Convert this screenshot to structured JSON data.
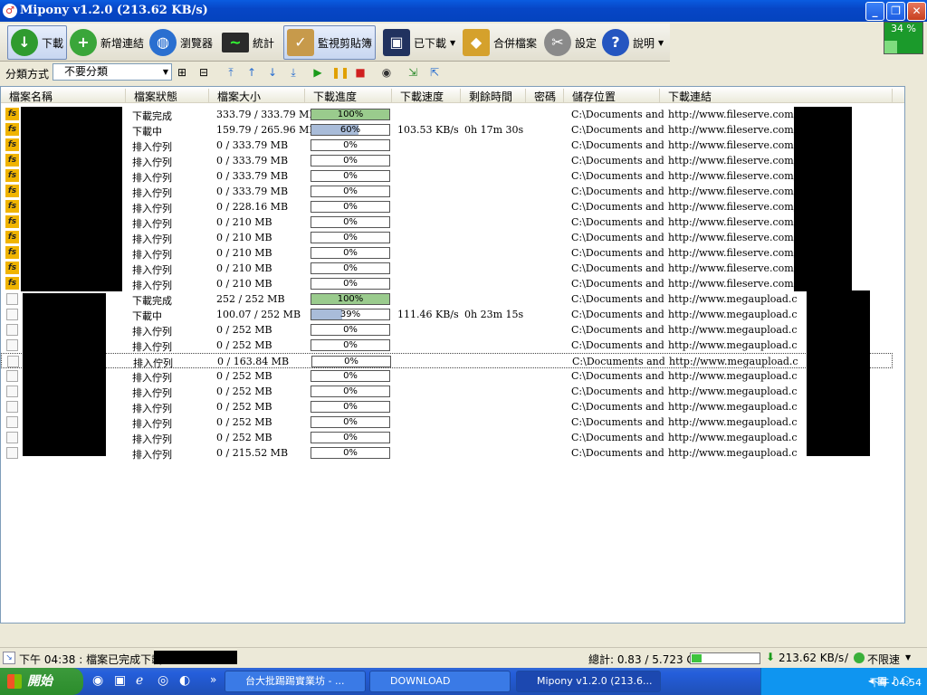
{
  "window": {
    "title": "Mipony v1.2.0 (213.62 KB/s)",
    "speed_meter": {
      "percent_label": "34 %",
      "fraction": 0.34
    }
  },
  "toolbar": {
    "download": "下載",
    "add_link": "新增連結",
    "browser": "瀏覽器",
    "stats": "統計",
    "monitor_clipboard": "監視剪貼簿",
    "downloaded": "已下載",
    "merge_files": "合併檔案",
    "settings": "設定",
    "help": "說明"
  },
  "subbar": {
    "sort_label": "分類方式",
    "sort_value": "不要分類"
  },
  "columns": [
    "檔案名稱",
    "檔案狀態",
    "檔案大小",
    "下載進度",
    "下載速度",
    "剩餘時間",
    "密碼",
    "儲存位置",
    "下載連結"
  ],
  "rows": [
    {
      "host": "fs",
      "status": "下載完成",
      "size": "333.79 / 333.79 MB",
      "progress": 100,
      "progress_label": "100%",
      "speed": "",
      "remaining": "",
      "location": "C:\\Documents and...",
      "link": "http://www.fileserve.com/file/j"
    },
    {
      "host": "fs",
      "status": "下載中",
      "size": "159.79 / 265.96 MB",
      "progress": 60,
      "progress_label": "60%",
      "speed": "103.53 KB/s",
      "remaining": "0h 17m 30s",
      "location": "C:\\Documents and...",
      "link": "http://www.fileserve.com/file/r"
    },
    {
      "host": "fs",
      "status": "排入佇列",
      "size": "0 / 333.79 MB",
      "progress": 0,
      "progress_label": "0%",
      "speed": "",
      "remaining": "",
      "location": "C:\\Documents and...",
      "link": "http://www.fileserve.com/file/8"
    },
    {
      "host": "fs",
      "status": "排入佇列",
      "size": "0 / 333.79 MB",
      "progress": 0,
      "progress_label": "0%",
      "speed": "",
      "remaining": "",
      "location": "C:\\Documents and...",
      "link": "http://www.fileserve.com/file/c"
    },
    {
      "host": "fs",
      "status": "排入佇列",
      "size": "0 / 333.79 MB",
      "progress": 0,
      "progress_label": "0%",
      "speed": "",
      "remaining": "",
      "location": "C:\\Documents and...",
      "link": "http://www.fileserve.com/file/2"
    },
    {
      "host": "fs",
      "status": "排入佇列",
      "size": "0 / 333.79 MB",
      "progress": 0,
      "progress_label": "0%",
      "speed": "",
      "remaining": "",
      "location": "C:\\Documents and...",
      "link": "http://www.fileserve.com/file/h"
    },
    {
      "host": "fs",
      "status": "排入佇列",
      "size": "0 / 228.16 MB",
      "progress": 0,
      "progress_label": "0%",
      "speed": "",
      "remaining": "",
      "location": "C:\\Documents and...",
      "link": "http://www.fileserve.com/file/a"
    },
    {
      "host": "fs",
      "status": "排入佇列",
      "size": "0 / 210 MB",
      "progress": 0,
      "progress_label": "0%",
      "speed": "",
      "remaining": "",
      "location": "C:\\Documents and...",
      "link": "http://www.fileserve.com/file/q"
    },
    {
      "host": "fs",
      "status": "排入佇列",
      "size": "0 / 210 MB",
      "progress": 0,
      "progress_label": "0%",
      "speed": "",
      "remaining": "",
      "location": "C:\\Documents and...",
      "link": "http://www.fileserve.com/file/7"
    },
    {
      "host": "fs",
      "status": "排入佇列",
      "size": "0 / 210 MB",
      "progress": 0,
      "progress_label": "0%",
      "speed": "",
      "remaining": "",
      "location": "C:\\Documents and...",
      "link": "http://www.fileserve.com/file/3"
    },
    {
      "host": "fs",
      "status": "排入佇列",
      "size": "0 / 210 MB",
      "progress": 0,
      "progress_label": "0%",
      "speed": "",
      "remaining": "",
      "location": "C:\\Documents and...",
      "link": "http://www.fileserve.com/file/y"
    },
    {
      "host": "fs",
      "status": "排入佇列",
      "size": "0 / 210 MB",
      "progress": 0,
      "progress_label": "0%",
      "speed": "",
      "remaining": "",
      "location": "C:\\Documents and...",
      "link": "http://www.fileserve.com/file/k"
    },
    {
      "host": "mu",
      "status": "下載完成",
      "size": "252 / 252 MB",
      "progress": 100,
      "progress_label": "100%",
      "speed": "",
      "remaining": "",
      "location": "C:\\Documents and...",
      "link": "http://www.megaupload.com/?d="
    },
    {
      "host": "mu",
      "status": "下載中",
      "size": "100.07 / 252 MB",
      "progress": 39,
      "progress_label": "39%",
      "speed": "111.46 KB/s",
      "remaining": "0h 23m 15s",
      "location": "C:\\Documents and...",
      "link": "http://www.megaupload.com/?d="
    },
    {
      "host": "mu",
      "status": "排入佇列",
      "size": "0 / 252 MB",
      "progress": 0,
      "progress_label": "0%",
      "speed": "",
      "remaining": "",
      "location": "C:\\Documents and...",
      "link": "http://www.megaupload.com/?d="
    },
    {
      "host": "mu",
      "status": "排入佇列",
      "size": "0 / 252 MB",
      "progress": 0,
      "progress_label": "0%",
      "speed": "",
      "remaining": "",
      "location": "C:\\Documents and...",
      "link": "http://www.megaupload.com/?d="
    },
    {
      "host": "mu",
      "status": "排入佇列",
      "size": "0 / 163.84 MB",
      "progress": 0,
      "progress_label": "0%",
      "speed": "",
      "remaining": "",
      "location": "C:\\Documents and...",
      "link": "http://www.megaupload.com/?d="
    },
    {
      "host": "mu",
      "status": "排入佇列",
      "size": "0 / 252 MB",
      "progress": 0,
      "progress_label": "0%",
      "speed": "",
      "remaining": "",
      "location": "C:\\Documents and...",
      "link": "http://www.megaupload.com/?d="
    },
    {
      "host": "mu",
      "status": "排入佇列",
      "size": "0 / 252 MB",
      "progress": 0,
      "progress_label": "0%",
      "speed": "",
      "remaining": "",
      "location": "C:\\Documents and...",
      "link": "http://www.megaupload.com/?d="
    },
    {
      "host": "mu",
      "status": "排入佇列",
      "size": "0 / 252 MB",
      "progress": 0,
      "progress_label": "0%",
      "speed": "",
      "remaining": "",
      "location": "C:\\Documents and...",
      "link": "http://www.megaupload.com/?d="
    },
    {
      "host": "mu",
      "status": "排入佇列",
      "size": "0 / 252 MB",
      "progress": 0,
      "progress_label": "0%",
      "speed": "",
      "remaining": "",
      "location": "C:\\Documents and...",
      "link": "http://www.megaupload.com/?d="
    },
    {
      "host": "mu",
      "status": "排入佇列",
      "size": "0 / 252 MB",
      "progress": 0,
      "progress_label": "0%",
      "speed": "",
      "remaining": "",
      "location": "C:\\Documents and...",
      "link": "http://www.megaupload.com/?d="
    },
    {
      "host": "mu",
      "status": "排入佇列",
      "size": "0 / 215.52 MB",
      "progress": 0,
      "progress_label": "0%",
      "speed": "",
      "remaining": "",
      "location": "C:\\Documents and...",
      "link": "http://www.megaupload.com/?d="
    }
  ],
  "statusbar": {
    "message": "下午 04:38 : 檔案已完成下載",
    "total": "總計: 0.83 / 5.723 GB",
    "total_fraction": 0.145,
    "speed": "213.62 KB/s",
    "limit": "不限速"
  },
  "taskbar": {
    "start": "開始",
    "tasks": [
      "台大批踢踢實業坊 - ...",
      "DOWNLOAD",
      "Mipony v1.2.0 (213.6..."
    ],
    "clock": "下午 04:54"
  }
}
